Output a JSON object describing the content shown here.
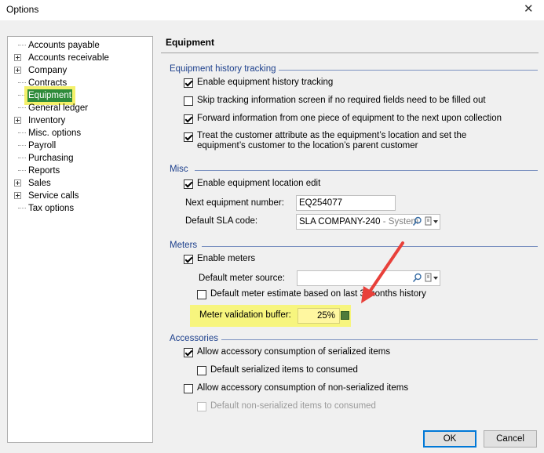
{
  "window": {
    "title": "Options",
    "close_glyph": "✕"
  },
  "tree": {
    "items": [
      {
        "label": "Accounts payable",
        "expandable": false
      },
      {
        "label": "Accounts receivable",
        "expandable": true
      },
      {
        "label": "Company",
        "expandable": true
      },
      {
        "label": "Contracts",
        "expandable": false
      },
      {
        "label": "Equipment",
        "expandable": false,
        "selected": true
      },
      {
        "label": "General ledger",
        "expandable": false
      },
      {
        "label": "Inventory",
        "expandable": true
      },
      {
        "label": "Misc. options",
        "expandable": false
      },
      {
        "label": "Payroll",
        "expandable": false
      },
      {
        "label": "Purchasing",
        "expandable": false
      },
      {
        "label": "Reports",
        "expandable": false
      },
      {
        "label": "Sales",
        "expandable": true
      },
      {
        "label": "Service calls",
        "expandable": true
      },
      {
        "label": "Tax options",
        "expandable": false
      }
    ]
  },
  "section_title": "Equipment",
  "history": {
    "title": "Equipment history tracking",
    "enable": {
      "label": "Enable equipment history tracking",
      "checked": true
    },
    "skip": {
      "label": "Skip tracking information screen if no required fields need to be filled out",
      "checked": false
    },
    "forward": {
      "label": "Forward information from one piece of equipment to the next upon collection",
      "checked": true
    },
    "treat": {
      "line1": "Treat the customer attribute as the equipment’s location and set the",
      "line2": "equipment’s customer to the location’s parent customer",
      "checked": true
    }
  },
  "misc": {
    "title": "Misc",
    "location_edit": {
      "label": "Enable equipment location edit",
      "checked": true
    },
    "next_number": {
      "label": "Next equipment number:",
      "value": "EQ254077"
    },
    "sla": {
      "label": "Default SLA code:",
      "value": "SLA COMPANY-240",
      "suffix": " - System"
    }
  },
  "meters": {
    "title": "Meters",
    "enable": {
      "label": "Enable meters",
      "checked": true
    },
    "source": {
      "label": "Default meter source:",
      "value": ""
    },
    "estimate": {
      "label": "Default meter estimate based on last 3 months history",
      "checked": false
    },
    "buffer": {
      "label": "Meter validation buffer:",
      "value": "25%"
    }
  },
  "accessories": {
    "title": "Accessories",
    "serialized": {
      "label": "Allow accessory consumption of serialized items",
      "checked": true
    },
    "serialized_default": {
      "label": "Default serialized items to consumed",
      "checked": false
    },
    "nonserialized": {
      "label": "Allow accessory consumption of non-serialized items",
      "checked": false
    },
    "nonserialized_default": {
      "label": "Default non-serialized items to consumed",
      "checked": false,
      "disabled": true
    }
  },
  "buttons": {
    "ok": "OK",
    "cancel": "Cancel"
  },
  "annotation": {
    "arrow_color": "#e8403a",
    "highlight_color": "#f7f57e"
  }
}
